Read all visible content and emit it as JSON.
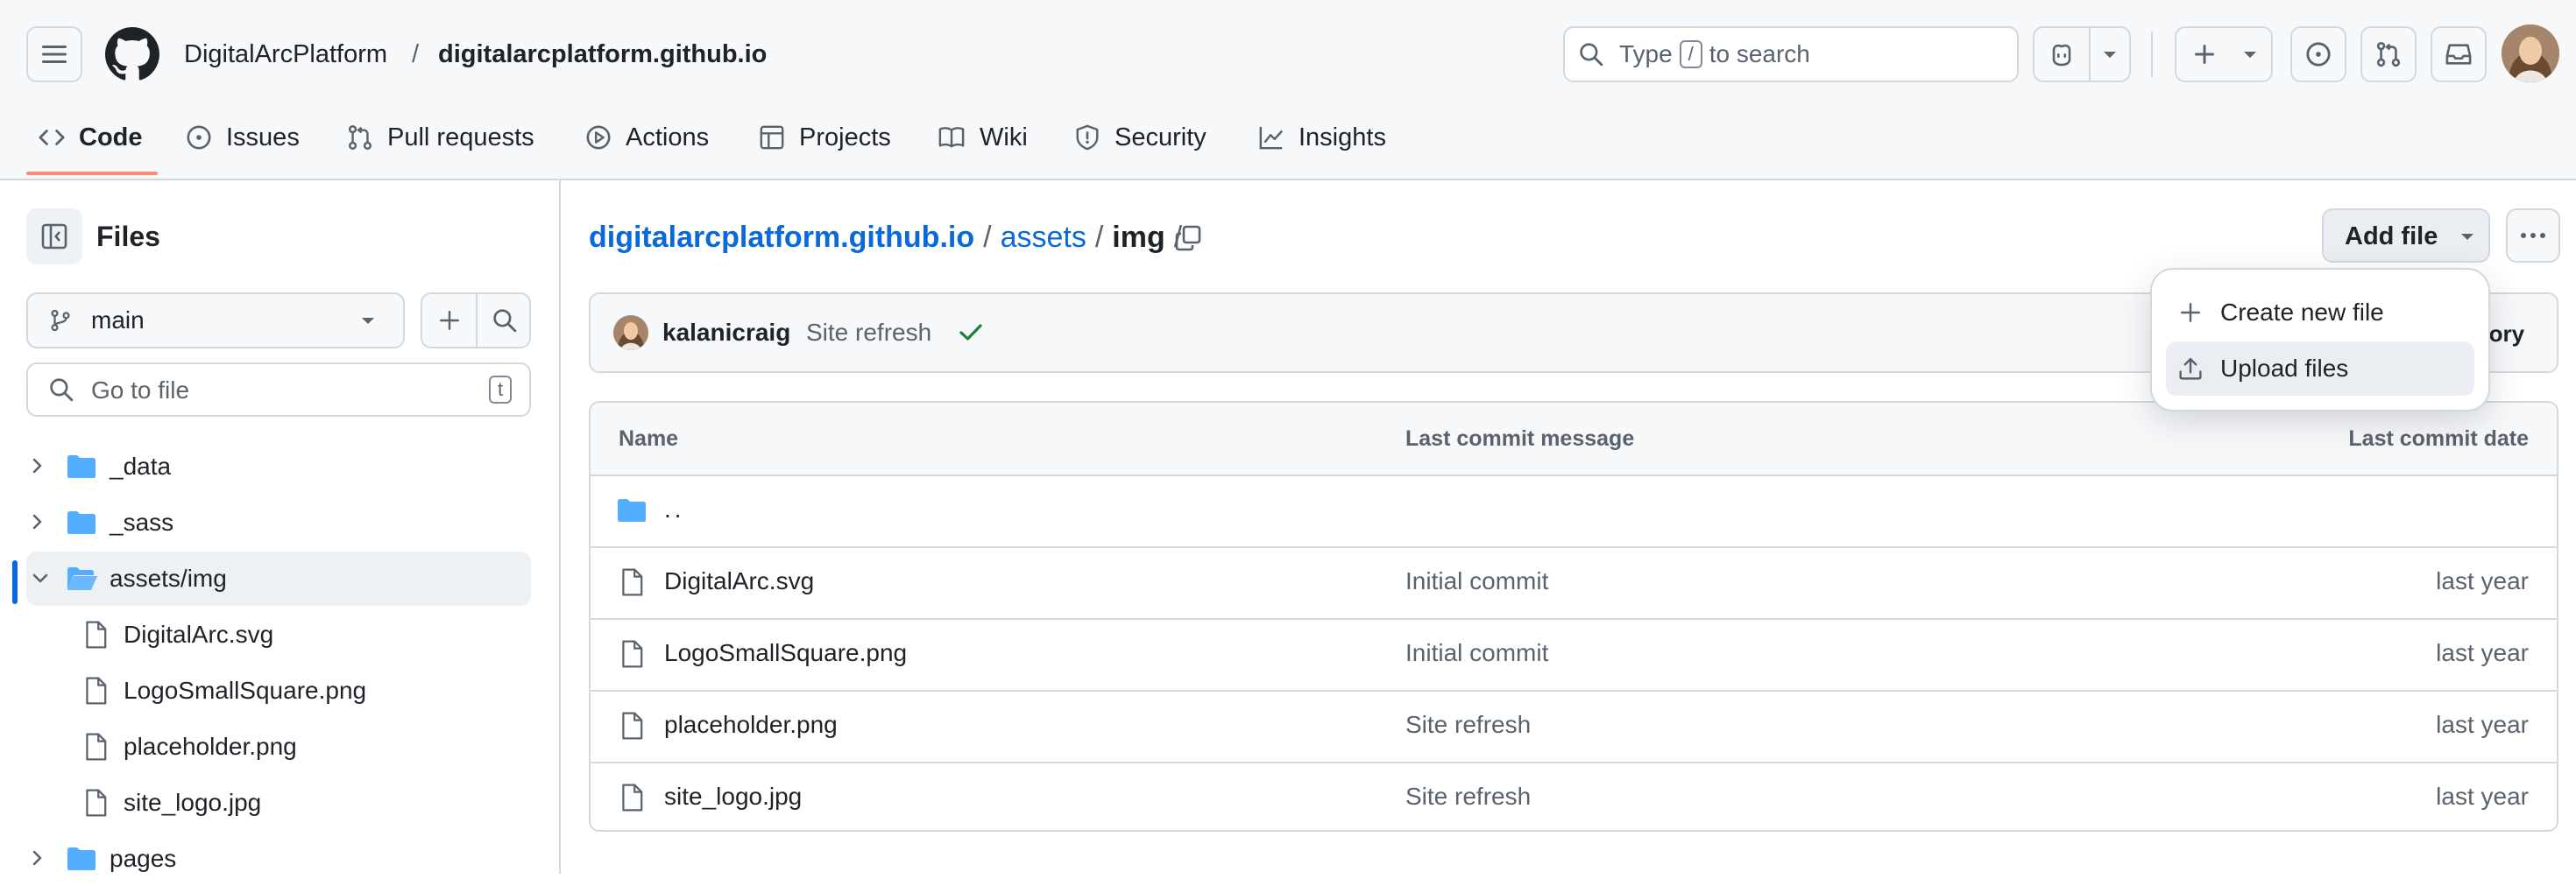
{
  "header": {
    "owner": "DigitalArcPlatform",
    "separator": "/",
    "repo": "digitalarcplatform.github.io",
    "search": {
      "prefix": "Type",
      "key": "/",
      "suffix": "to search"
    }
  },
  "tabs": [
    {
      "label": "Code",
      "icon": "code-icon"
    },
    {
      "label": "Issues",
      "icon": "issue-icon"
    },
    {
      "label": "Pull requests",
      "icon": "pull-request-icon"
    },
    {
      "label": "Actions",
      "icon": "play-icon"
    },
    {
      "label": "Projects",
      "icon": "table-icon"
    },
    {
      "label": "Wiki",
      "icon": "book-icon"
    },
    {
      "label": "Security",
      "icon": "shield-icon"
    },
    {
      "label": "Insights",
      "icon": "graph-icon"
    }
  ],
  "sidebar": {
    "title": "Files",
    "branch": "main",
    "go_to_file_placeholder": "Go to file",
    "go_to_file_key": "t",
    "tree": [
      {
        "label": "_data",
        "type": "folder",
        "expanded": false
      },
      {
        "label": "_sass",
        "type": "folder",
        "expanded": false
      },
      {
        "label": "assets/img",
        "type": "folder",
        "expanded": true,
        "selected": true
      },
      {
        "label": "DigitalArc.svg",
        "type": "file"
      },
      {
        "label": "LogoSmallSquare.png",
        "type": "file"
      },
      {
        "label": "placeholder.png",
        "type": "file"
      },
      {
        "label": "site_logo.jpg",
        "type": "file"
      },
      {
        "label": "pages",
        "type": "folder",
        "expanded": false
      }
    ]
  },
  "breadcrumb": {
    "root": "digitalarcplatform.github.io",
    "sep": "/",
    "assets": "assets",
    "current": "img",
    "trail": "/"
  },
  "toolbar": {
    "add_file": "Add file"
  },
  "commit_bar": {
    "author": "kalanicraig",
    "message": "Site refresh",
    "history_fragment": "tory"
  },
  "table": {
    "headers": {
      "name": "Name",
      "message": "Last commit message",
      "date": "Last commit date"
    },
    "parent": "..",
    "rows": [
      {
        "name": "DigitalArc.svg",
        "message": "Initial commit",
        "date": "last year"
      },
      {
        "name": "LogoSmallSquare.png",
        "message": "Initial commit",
        "date": "last year"
      },
      {
        "name": "placeholder.png",
        "message": "Site refresh",
        "date": "last year"
      },
      {
        "name": "site_logo.jpg",
        "message": "Site refresh",
        "date": "last year"
      }
    ]
  },
  "dropdown": {
    "items": [
      {
        "label": "Create new file",
        "icon": "plus-icon"
      },
      {
        "label": "Upload files",
        "icon": "upload-icon",
        "highlighted": true
      }
    ]
  },
  "colors": {
    "link": "#0969da",
    "folder": "#54aeff",
    "success": "#1a7f37",
    "tab_underline": "#fd8c73",
    "selected_marker": "#0969da"
  }
}
